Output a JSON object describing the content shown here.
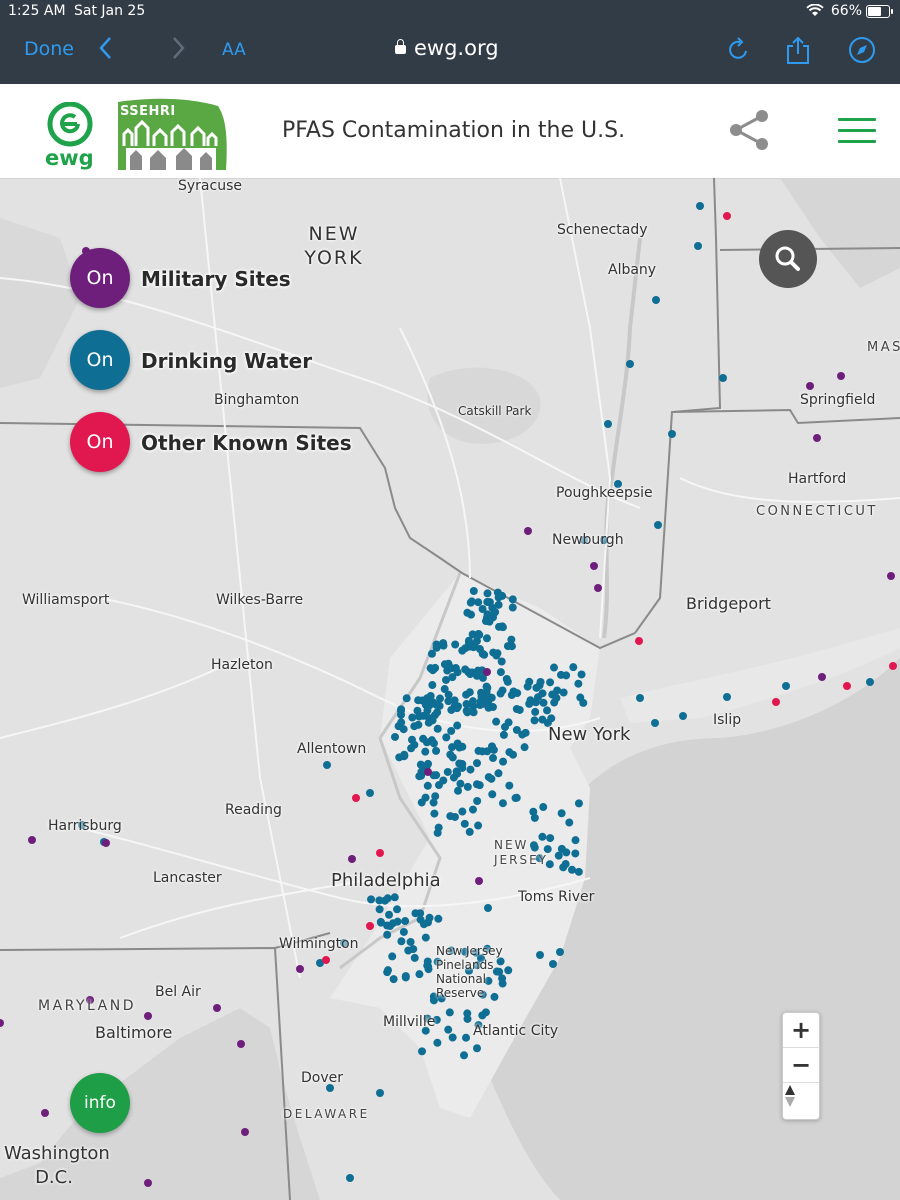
{
  "status": {
    "time": "1:25 AM",
    "date": "Sat Jan 25",
    "battery": "66%",
    "battery_level": 0.66
  },
  "browser": {
    "done_label": "Done",
    "text_size_label": "AA",
    "url": "ewg.org"
  },
  "header": {
    "logo_text": "ewg",
    "partner_logo_text": "SSEHRI",
    "title": "PFAS Contamination in the U.S."
  },
  "layers": [
    {
      "state": "On",
      "label": "Military Sites",
      "color": "#6e1f7c"
    },
    {
      "state": "On",
      "label": "Drinking Water",
      "color": "#0f6e94"
    },
    {
      "state": "On",
      "label": "Other Known Sites",
      "color": "#e0184f"
    }
  ],
  "info_label": "info",
  "zoom": {
    "in": "+",
    "out": "−"
  },
  "map": {
    "states": {
      "new_york": "NEW YORK",
      "connecticut": "CONNECTICUT",
      "massachusetts": "MAS",
      "new_jersey": "NEW JERSEY",
      "maryland": "MARYLAND",
      "delaware": "DELAWARE"
    },
    "cities": {
      "syracuse": "Syracuse",
      "schenectady": "Schenectady",
      "albany": "Albany",
      "springfield": "Springfield",
      "binghamton": "Binghamton",
      "catskill": "Catskill Park",
      "hartford": "Hartford",
      "poughkeepsie": "Poughkeepsie",
      "newburgh": "Newburgh",
      "williamsport": "Williamsport",
      "wilkes_barre": "Wilkes-Barre",
      "bridgeport": "Bridgeport",
      "hazleton": "Hazleton",
      "islip": "Islip",
      "allentown": "Allentown",
      "new_york": "New York",
      "reading": "Reading",
      "harrisburg": "Harrisburg",
      "lancaster": "Lancaster",
      "philadelphia": "Philadelphia",
      "toms_river": "Toms River",
      "wilmington": "Wilmington",
      "pinelands": "New Jersey Pinelands National Reserve",
      "bel_air": "Bel Air",
      "baltimore": "Baltimore",
      "millville": "Millville",
      "atlantic_city": "Atlantic City",
      "dover": "Dover",
      "washington": "Washington D.C."
    }
  },
  "colors": {
    "military": "#6e1f7c",
    "water": "#0f6e94",
    "other": "#e0184f",
    "brand_green": "#1ea24a"
  }
}
